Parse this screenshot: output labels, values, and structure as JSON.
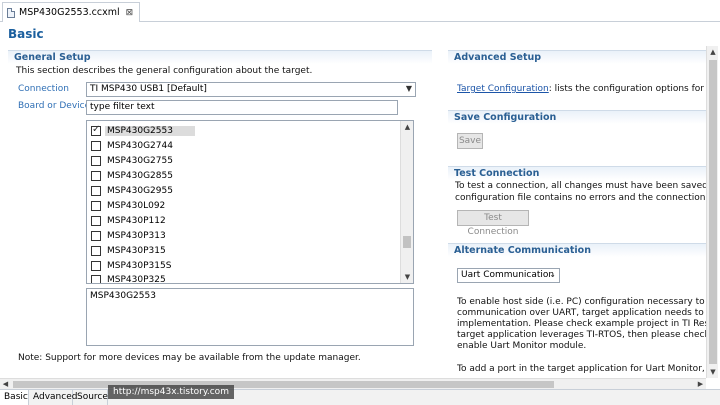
{
  "editor_tab": {
    "title": "MSP430G2553.ccxml",
    "close": "⊠"
  },
  "page_title": "Basic",
  "general": {
    "header": "General Setup",
    "description": "This section describes the general configuration about the target.",
    "connection_label": "Connection",
    "connection_value": "TI MSP430 USB1 [Default]",
    "board_label": "Board or Device",
    "filter_placeholder": "type filter text",
    "devices": [
      {
        "name": "MSP430G2553",
        "checked": true
      },
      {
        "name": "MSP430G2744",
        "checked": false
      },
      {
        "name": "MSP430G2755",
        "checked": false
      },
      {
        "name": "MSP430G2855",
        "checked": false
      },
      {
        "name": "MSP430G2955",
        "checked": false
      },
      {
        "name": "MSP430L092",
        "checked": false
      },
      {
        "name": "MSP430P112",
        "checked": false
      },
      {
        "name": "MSP430P313",
        "checked": false
      },
      {
        "name": "MSP430P315",
        "checked": false
      },
      {
        "name": "MSP430P315S",
        "checked": false
      },
      {
        "name": "MSP430P325",
        "checked": false
      }
    ],
    "selected_device": "MSP430G2553",
    "note": "Note: Support for more devices may be available from the update manager."
  },
  "advanced": {
    "header": "Advanced Setup",
    "link": "Target Configuration",
    "link_suffix": ": lists the configuration options for the ta"
  },
  "save": {
    "header": "Save Configuration",
    "button": "Save"
  },
  "test": {
    "header": "Test Connection",
    "line1": "To test a connection, all changes must have been saved, the",
    "line2": "configuration file contains no errors and the connection type s",
    "button": "Test Connection"
  },
  "alternate": {
    "header": "Alternate Communication",
    "combo_value": "Uart Communication",
    "lines": [
      "To enable host side (i.e. PC) configuration necessary to facilita",
      "communication over UART, target application needs to includ",
      "implementation. Please check example project in TI Resource",
      "target application leverages TI-RTOS, then please check docun",
      "enable Uart Monitor module."
    ],
    "last_line": "To add a port in the target application for Uart Monitor, click"
  },
  "bottom_tabs": [
    "Basic",
    "Advanced",
    "Source"
  ],
  "watermark": "http://msp43x.tistory.com"
}
